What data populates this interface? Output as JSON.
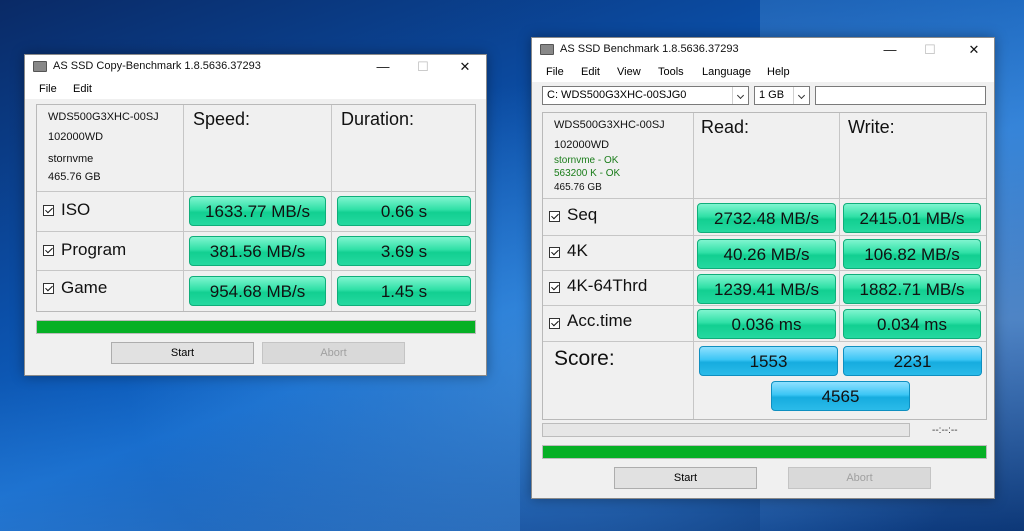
{
  "copy_window": {
    "title": "AS SSD Copy-Benchmark 1.8.5636.37293",
    "menu": [
      "File",
      "Edit"
    ],
    "controls": {
      "minimize": "—",
      "maximize": "☐",
      "close": "✕"
    },
    "drive_info": [
      "WDS500G3XHC-00SJ",
      "102000WD",
      "stornvme",
      "465.76 GB"
    ],
    "headers": {
      "speed": "Speed:",
      "duration": "Duration:"
    },
    "rows": [
      {
        "label": "ISO",
        "speed": "1633.77 MB/s",
        "duration": "0.66 s"
      },
      {
        "label": "Program",
        "speed": "381.56 MB/s",
        "duration": "3.69 s"
      },
      {
        "label": "Game",
        "speed": "954.68 MB/s",
        "duration": "1.45 s"
      }
    ],
    "progress_fraction": 1.0,
    "start_label": "Start",
    "abort_label": "Abort"
  },
  "bench_window": {
    "title": "AS SSD Benchmark 1.8.5636.37293",
    "menu": [
      "File",
      "Edit",
      "View",
      "Tools",
      "Language",
      "Help"
    ],
    "controls": {
      "minimize": "—",
      "maximize": "☐",
      "close": "✕"
    },
    "drive_select": "C: WDS500G3XHC-00SJG0",
    "size_select": "1 GB",
    "drive_info": [
      "WDS500G3XHC-00SJ",
      "102000WD",
      "stornvme - OK",
      "563200 K - OK",
      "465.76 GB"
    ],
    "headers": {
      "read": "Read:",
      "write": "Write:"
    },
    "rows": [
      {
        "label": "Seq",
        "read": "2732.48 MB/s",
        "write": "2415.01 MB/s"
      },
      {
        "label": "4K",
        "read": "40.26 MB/s",
        "write": "106.82 MB/s"
      },
      {
        "label": "4K-64Thrd",
        "read": "1239.41 MB/s",
        "write": "1882.71 MB/s"
      },
      {
        "label": "Acc.time",
        "read": "0.036 ms",
        "write": "0.034 ms"
      }
    ],
    "score_label": "Score:",
    "score_read": "1553",
    "score_write": "2231",
    "score_total": "4565",
    "elapsed_time": "--:--:--",
    "progress_fraction": 1.0,
    "start_label": "Start",
    "abort_label": "Abort"
  },
  "colors": {
    "result_green": "#2fe0a6",
    "score_blue": "#3cc6f5",
    "progress_green": "#06b025",
    "ok_text": "#1a7d1a"
  }
}
